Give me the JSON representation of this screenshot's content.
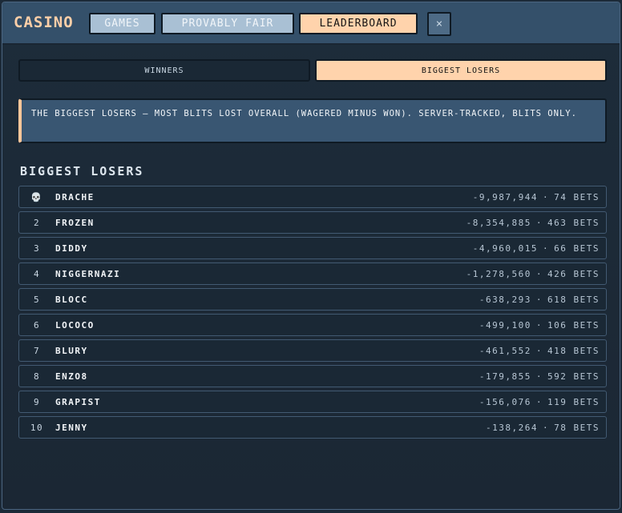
{
  "header": {
    "brand": "CASINO",
    "nav": [
      {
        "label": "GAMES",
        "active": false
      },
      {
        "label": "PROVABLY FAIR",
        "active": false
      },
      {
        "label": "LEADERBOARD",
        "active": true
      }
    ],
    "close_icon": "close-icon",
    "close_glyph": "×"
  },
  "tabs": {
    "winners": "WINNERS",
    "losers": "BIGGEST LOSERS"
  },
  "notice": "THE BIGGEST LOSERS — MOST BLITS LOST OVERALL (WAGERED MINUS WON). SERVER-TRACKED, BLITS ONLY.",
  "section_title": "BIGGEST LOSERS",
  "leaderboard": [
    {
      "rank": "💀",
      "name": "DRACHE",
      "amount": "-9,987,944",
      "bets": "74 BETS"
    },
    {
      "rank": "2",
      "name": "FROZEN",
      "amount": "-8,354,885",
      "bets": "463 BETS"
    },
    {
      "rank": "3",
      "name": "DIDDY",
      "amount": "-4,960,015",
      "bets": "66 BETS"
    },
    {
      "rank": "4",
      "name": "NIGGERNAZI",
      "amount": "-1,278,560",
      "bets": "426 BETS"
    },
    {
      "rank": "5",
      "name": "BLOCC",
      "amount": "-638,293",
      "bets": "618 BETS"
    },
    {
      "rank": "6",
      "name": "LOCOCO",
      "amount": "-499,100",
      "bets": "106 BETS"
    },
    {
      "rank": "7",
      "name": "BLURY",
      "amount": "-461,552",
      "bets": "418 BETS"
    },
    {
      "rank": "8",
      "name": "ENZO8",
      "amount": "-179,855",
      "bets": "592 BETS"
    },
    {
      "rank": "9",
      "name": "GRAPIST",
      "amount": "-156,076",
      "bets": "119 BETS"
    },
    {
      "rank": "10",
      "name": "JENNY",
      "amount": "-138,264",
      "bets": "78 BETS"
    }
  ],
  "separator": "·",
  "colors": {
    "accent": "#ffd3ac",
    "panel": "#395672",
    "background": "#1c2a38"
  }
}
